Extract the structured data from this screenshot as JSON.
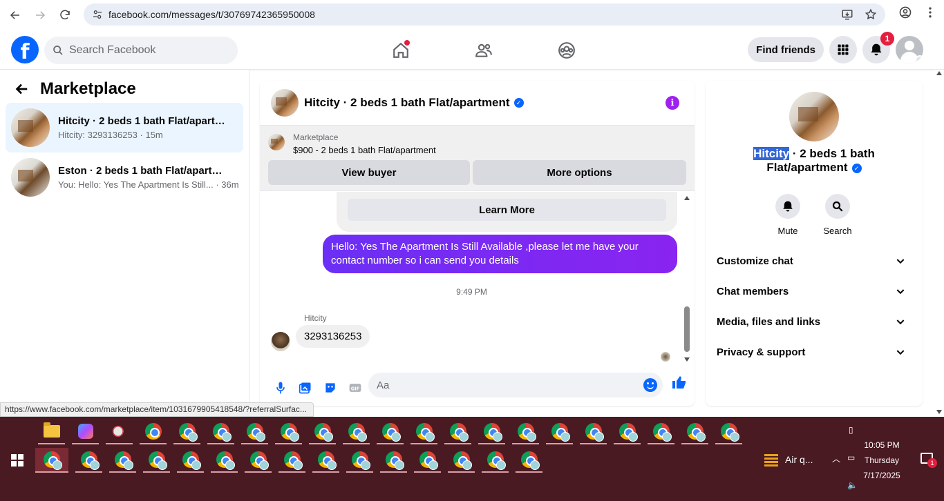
{
  "browser": {
    "url": "facebook.com/messages/t/30769742365950008"
  },
  "fbnav": {
    "search_placeholder": "Search Facebook",
    "find_friends": "Find friends",
    "notification_count": "1"
  },
  "sidebar": {
    "title": "Marketplace",
    "conversations": [
      {
        "title": "Hitcity · 2 beds 1 bath Flat/apartm...",
        "preview": "Hitcity: 3293136253 · 15m"
      },
      {
        "title": "Eston · 2 beds 1 bath Flat/apartment",
        "preview": "You: Hello: Yes The Apartment Is Still... · 36m"
      }
    ]
  },
  "chat": {
    "title": "Hitcity · 2 beds 1 bath Flat/apartment",
    "marketplace_label": "Marketplace",
    "listing": "$900 - 2 beds 1 bath Flat/apartment",
    "view_buyer": "View buyer",
    "more_options": "More options",
    "learn_more": "Learn More",
    "outgoing_message": "Hello: Yes The Apartment Is Still Available ,please let me have your contact number so i can send you details",
    "timestamp": "9:49 PM",
    "sender": "Hitcity",
    "incoming_message": "3293136253",
    "composer_placeholder": "Aa"
  },
  "details": {
    "name_highlight": "Hitcity",
    "name_rest": " · 2 beds 1 bath",
    "name_line2": "Flat/apartment",
    "mute": "Mute",
    "search": "Search",
    "sections": [
      "Customize chat",
      "Chat members",
      "Media, files and links",
      "Privacy & support"
    ]
  },
  "status_bar_url": "https://www.facebook.com/marketplace/item/1031679905418548/?referralSurfac...",
  "taskbar": {
    "weather": "Air q...",
    "time": "10:05 PM",
    "day": "Thursday",
    "date": "7/17/2025",
    "notification_count": "1"
  },
  "colors": {
    "fb_blue": "#0866ff",
    "message_purple": "#7b2cf0",
    "taskbar": "#4a1a22"
  }
}
